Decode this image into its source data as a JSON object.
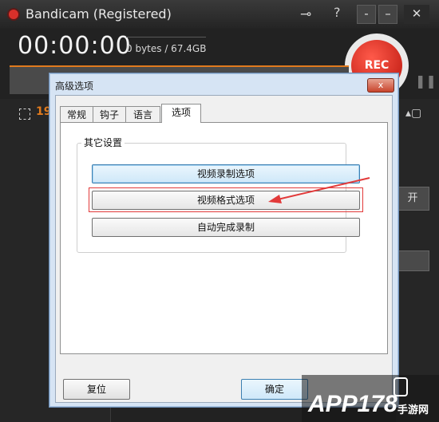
{
  "main_window": {
    "title": "Bandicam (Registered)",
    "timer": "00:00:00",
    "file_size": "0 bytes / 67.4GB",
    "rec_label": "REC",
    "resolution": "19",
    "open_button": "开",
    "icons": [
      "record-dot-icon",
      "key-icon",
      "help-icon",
      "minimize-icon",
      "close-icon",
      "pause-icon",
      "screen-select-icon"
    ],
    "window_buttons": {
      "menu": "-",
      "minimize": "–",
      "close": "✕"
    },
    "accent_color": "#e07a1d",
    "rec_color": "#d8302a"
  },
  "dialog": {
    "title": "高级选项",
    "close_label": "x",
    "tabs": [
      {
        "label": "常规",
        "active": false
      },
      {
        "label": "钩子",
        "active": false
      },
      {
        "label": "语言",
        "active": false
      },
      {
        "label": "选项",
        "active": true
      }
    ],
    "group": {
      "label": "其它设置",
      "buttons": [
        {
          "label": "视频录制选项"
        },
        {
          "label": "视频格式选项"
        },
        {
          "label": "自动完成录制"
        }
      ]
    },
    "footer": {
      "reset_label": "复位",
      "ok_label": "确定"
    },
    "annotation_color": "#e23a3a"
  },
  "watermark": {
    "text": "APP178",
    "subtext": "手游网"
  }
}
